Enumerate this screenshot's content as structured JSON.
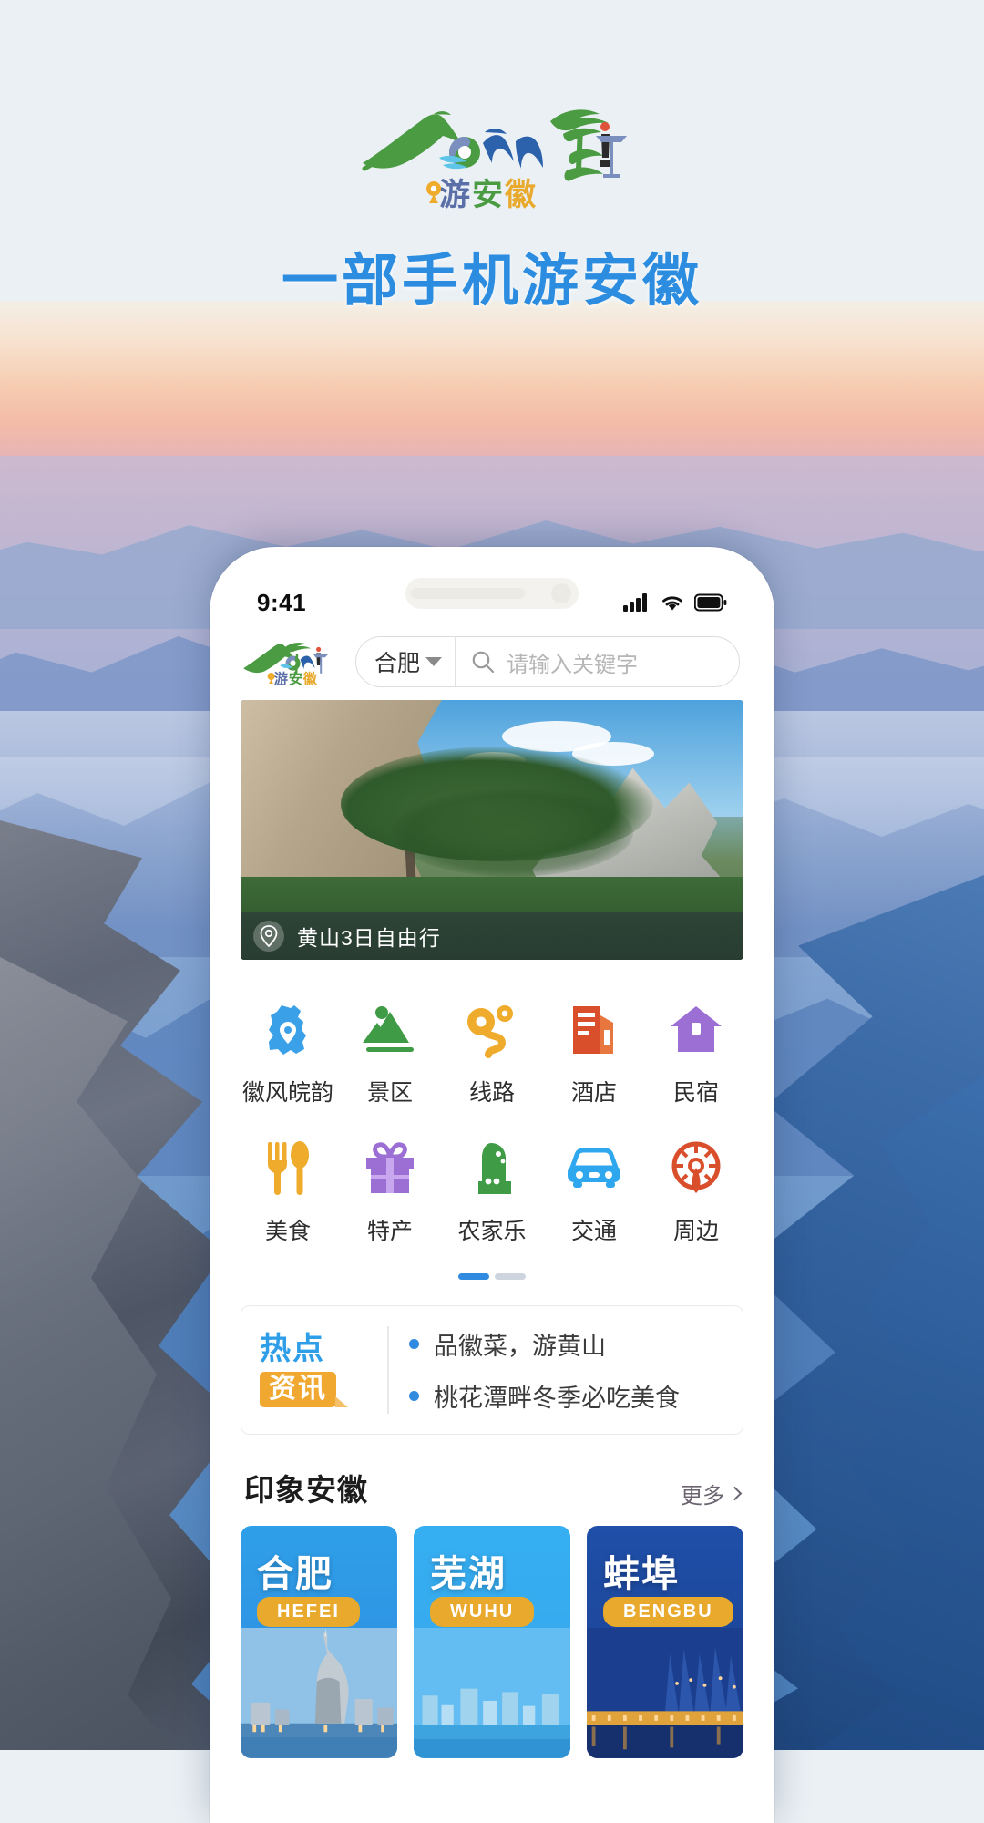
{
  "poster": {
    "logo_alt": "anhui-tourism-logo",
    "logo_cn": "游安徽",
    "title": "一部手机游安徽"
  },
  "phone": {
    "status_bar": {
      "time": "9:41",
      "signal_icon": "cellular-signal-icon",
      "wifi_icon": "wifi-icon",
      "battery_icon": "battery-icon"
    },
    "header": {
      "logo_cn": "游安徽",
      "city": "合肥",
      "city_caret_icon": "chevron-down-icon",
      "search_icon": "search-icon",
      "search_placeholder": "请输入关键字",
      "search_value": ""
    },
    "hero": {
      "pin_icon": "location-pin-icon",
      "caption": "黄山3日自由行"
    },
    "grid": {
      "rows": [
        [
          {
            "label": "徽风皖韵",
            "icon": "province-map-icon",
            "color": "#3aa0e8"
          },
          {
            "label": "景区",
            "icon": "mountain-icon",
            "color": "#3f9b45"
          },
          {
            "label": "线路",
            "icon": "route-icon",
            "color": "#efab2c"
          },
          {
            "label": "酒店",
            "icon": "hotel-building-icon",
            "color": "#d94f2b"
          },
          {
            "label": "民宿",
            "icon": "house-icon",
            "color": "#9b6fd4"
          }
        ],
        [
          {
            "label": "美食",
            "icon": "fork-spoon-icon",
            "color": "#efab2c"
          },
          {
            "label": "特产",
            "icon": "gift-box-icon",
            "color": "#9b6fd4"
          },
          {
            "label": "农家乐",
            "icon": "farm-house-icon",
            "color": "#3f9b45"
          },
          {
            "label": "交通",
            "icon": "car-icon",
            "color": "#2fa7ef"
          },
          {
            "label": "周边",
            "icon": "ferris-wheel-icon",
            "color": "#d94f2b"
          }
        ]
      ],
      "pager": {
        "active_index": 0,
        "count": 2
      }
    },
    "news": {
      "badge_top": "热点",
      "badge_bottom": "资讯",
      "items": [
        "品徽菜，游黄山",
        "桃花潭畔冬季必吃美食"
      ]
    },
    "impression": {
      "title": "印象安徽",
      "more_label": "更多",
      "more_icon": "chevron-right-icon",
      "cities": [
        {
          "name": "合肥",
          "en": "HEFEI"
        },
        {
          "name": "芜湖",
          "en": "WUHU"
        },
        {
          "name": "蚌埠",
          "en": "BENGBU"
        }
      ]
    }
  },
  "colors": {
    "brand_blue": "#2b8ce0",
    "brand_green": "#4a9b42",
    "badge_orange": "#e8a92c"
  }
}
